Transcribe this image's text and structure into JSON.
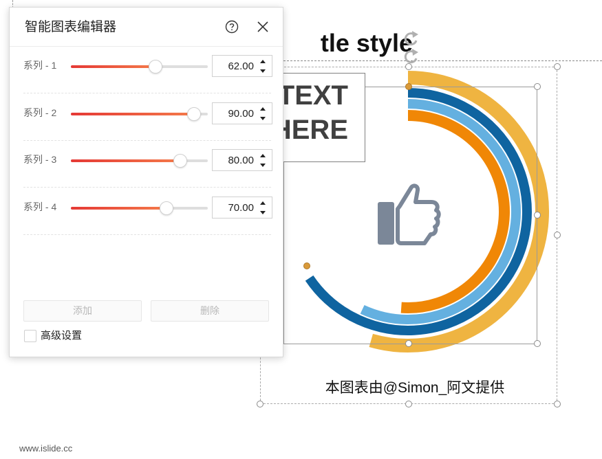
{
  "slide": {
    "title": "tle style",
    "textbox_lines": [
      "TEXT",
      "HERE"
    ],
    "caption": "本图表由@Simon_阿文提供",
    "watermark": "www.islide.cc"
  },
  "panel": {
    "title": "智能图表编辑器",
    "help_icon": "question-circle-icon",
    "close_icon": "close-icon",
    "series": [
      {
        "label": "系列 -  1",
        "value": 62,
        "display": "62.00"
      },
      {
        "label": "系列 -  2",
        "value": 90,
        "display": "90.00"
      },
      {
        "label": "系列 -  3",
        "value": 80,
        "display": "80.00"
      },
      {
        "label": "系列 -  4",
        "value": 70,
        "display": "70.00"
      }
    ],
    "slider_max": 100,
    "add_label": "添加",
    "delete_label": "删除",
    "advanced_label": "高级设置",
    "advanced_checked": false
  },
  "chart_data": {
    "type": "radial-bar",
    "series": [
      {
        "name": "系列 - 1",
        "value": 62,
        "color": "#0f64a0"
      },
      {
        "name": "系列 - 2",
        "value": 90,
        "color": "#efb441"
      },
      {
        "name": "系列 - 3",
        "value": 80,
        "color": "#0f64a0"
      },
      {
        "name": "系列 - 4",
        "value": 70,
        "color": "#f08706"
      }
    ],
    "ring_colors_outer_to_inner": [
      "#efb441",
      "#0f64a0",
      "#64b0e0",
      "#f08706"
    ],
    "center_icon": "thumbs-up-icon",
    "icon_color": "#7b8798",
    "max": 100
  },
  "colors": {
    "slider_start": "#e53935",
    "slider_end": "#f47a4a",
    "rotate_icon": "#b0b0b0"
  }
}
